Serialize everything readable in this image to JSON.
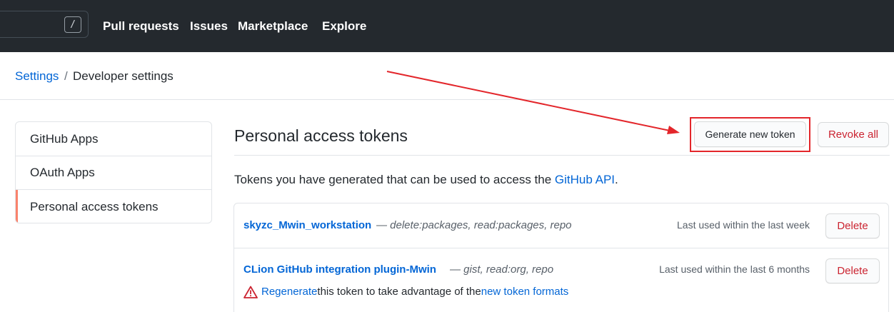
{
  "topbar": {
    "search_shortcut": "/",
    "nav": [
      "Pull requests",
      "Issues",
      "Marketplace",
      "Explore"
    ]
  },
  "breadcrumb": {
    "root": "Settings",
    "separator": "/",
    "current": "Developer settings"
  },
  "sidebar": {
    "items": [
      {
        "label": "GitHub Apps"
      },
      {
        "label": "OAuth Apps"
      },
      {
        "label": "Personal access tokens"
      }
    ]
  },
  "main": {
    "title": "Personal access tokens",
    "generate_label": "Generate new token",
    "revoke_label": "Revoke all",
    "description_prefix": "Tokens you have generated that can be used to access the ",
    "description_link": "GitHub API",
    "description_suffix": "."
  },
  "tokens": [
    {
      "name": "skyzc_Mwin_workstation",
      "scopes": "— delete:packages, read:packages, repo",
      "last_used": "Last used within the last week",
      "delete_label": "Delete"
    },
    {
      "name": "CLion GitHub integration plugin-Mwin",
      "scopes": "— gist, read:org, repo",
      "last_used": "Last used within the last 6 months",
      "delete_label": "Delete",
      "warning": {
        "link1": "Regenerate",
        "text": " this token to take advantage of the ",
        "link2": "new token formats"
      }
    }
  ],
  "colors": {
    "header_bg": "#24292e",
    "link": "#0366d6",
    "danger": "#cb2431",
    "annotation": "#e3262b",
    "active_marker": "#f9826c"
  },
  "icons": {
    "warning": "alert-triangle-icon",
    "annotation": "annotation-arrow"
  }
}
